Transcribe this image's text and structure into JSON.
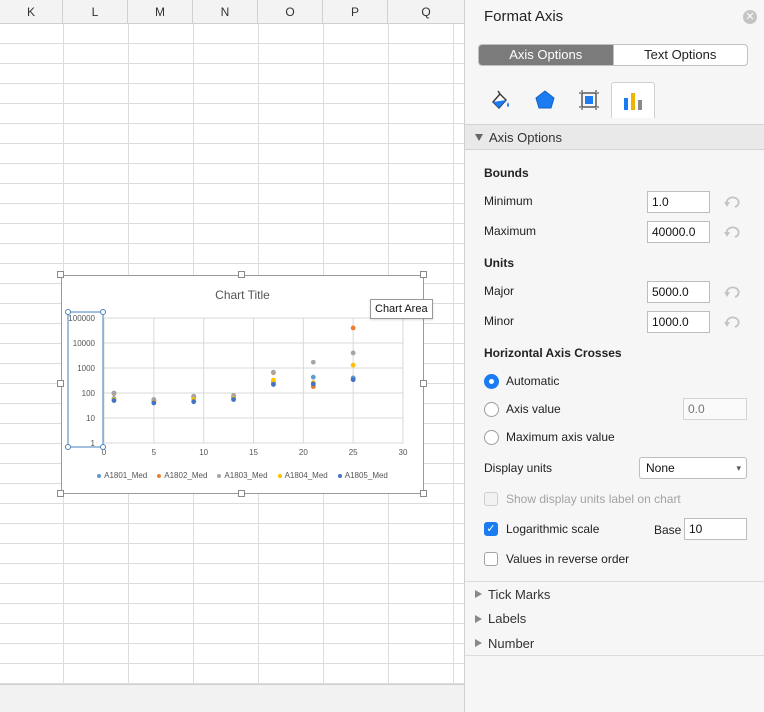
{
  "sheet": {
    "columns": [
      "K",
      "L",
      "M",
      "N",
      "O",
      "P",
      "Q"
    ]
  },
  "chart": {
    "title": "Chart Title",
    "tooltip": "Chart Area"
  },
  "chart_data": {
    "type": "scatter",
    "title": "Chart Title",
    "x_ticks": [
      "0",
      "5",
      "10",
      "15",
      "20",
      "25",
      "30"
    ],
    "y_ticks": [
      "1",
      "10",
      "100",
      "1000",
      "10000",
      "100000"
    ],
    "xlim": [
      0,
      30
    ],
    "ylim": [
      1,
      100000
    ],
    "y_scale": "log",
    "grid": true,
    "legend_position": "bottom",
    "series": [
      {
        "name": "A1801_Med",
        "color": "#5b9bd5",
        "points": [
          [
            1,
            60
          ],
          [
            5,
            50
          ],
          [
            9,
            60
          ],
          [
            13,
            65
          ],
          [
            17,
            260
          ],
          [
            21,
            430
          ],
          [
            25,
            400
          ]
        ]
      },
      {
        "name": "A1802_Med",
        "color": "#ed7d31",
        "points": [
          [
            1,
            95
          ],
          [
            5,
            48
          ],
          [
            9,
            70
          ],
          [
            13,
            70
          ],
          [
            17,
            650
          ],
          [
            21,
            180
          ],
          [
            25,
            40000
          ]
        ]
      },
      {
        "name": "A1803_Med",
        "color": "#a5a5a5",
        "points": [
          [
            1,
            100
          ],
          [
            5,
            55
          ],
          [
            9,
            75
          ],
          [
            13,
            80
          ],
          [
            17,
            680
          ],
          [
            21,
            1700
          ],
          [
            25,
            4000
          ]
        ]
      },
      {
        "name": "A1804_Med",
        "color": "#ffc000",
        "points": [
          [
            1,
            55
          ],
          [
            5,
            42
          ],
          [
            9,
            55
          ],
          [
            13,
            60
          ],
          [
            17,
            330
          ],
          [
            21,
            260
          ],
          [
            25,
            1300
          ]
        ]
      },
      {
        "name": "A1805_Med",
        "color": "#4472c4",
        "points": [
          [
            1,
            50
          ],
          [
            5,
            40
          ],
          [
            9,
            45
          ],
          [
            13,
            55
          ],
          [
            17,
            220
          ],
          [
            21,
            230
          ],
          [
            25,
            340
          ]
        ]
      }
    ]
  },
  "pane": {
    "title": "Format Axis",
    "close_icon": "close-icon",
    "tabs": [
      "Axis Options",
      "Text Options"
    ],
    "active_tab": "Axis Options",
    "icon_tabs": [
      "fill-line-icon",
      "effects-icon",
      "size-properties-icon",
      "axis-options-icon"
    ],
    "section_title": "Axis Options",
    "bounds_heading": "Bounds",
    "minimum_label": "Minimum",
    "minimum_value": "1.0",
    "maximum_label": "Maximum",
    "maximum_value": "40000.0",
    "units_heading": "Units",
    "major_label": "Major",
    "major_value": "5000.0",
    "minor_label": "Minor",
    "minor_value": "1000.0",
    "crosses_heading": "Horizontal Axis Crosses",
    "radio_automatic": "Automatic",
    "radio_axis_value": "Axis value",
    "axis_value_placeholder": "0.0",
    "radio_maximum": "Maximum axis value",
    "display_units_label": "Display units",
    "display_units_value": "None",
    "show_units_label": "Show display units label on chart",
    "log_scale_label": "Logarithmic scale",
    "log_scale_checked": true,
    "base_label": "Base",
    "base_value": "10",
    "reverse_label": "Values in reverse order",
    "collapsed_sections": [
      "Tick Marks",
      "Labels",
      "Number"
    ],
    "accent_color": "#1a7cf0"
  }
}
